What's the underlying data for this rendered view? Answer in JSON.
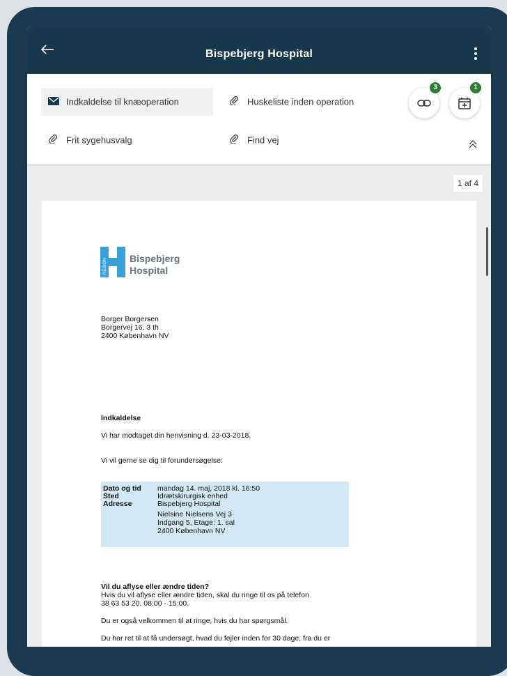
{
  "appbar": {
    "title": "Bispebjerg Hospital"
  },
  "attachments": {
    "items": [
      {
        "label": "Indkaldelse til knæoperation",
        "icon": "envelope-icon",
        "active": true
      },
      {
        "label": "Huskeliste inden operation",
        "icon": "paperclip-icon",
        "active": false
      },
      {
        "label": "Frit sygehusvalg",
        "icon": "paperclip-icon",
        "active": false
      },
      {
        "label": "Find vej",
        "icon": "paperclip-icon",
        "active": false
      }
    ],
    "links_badge": "3",
    "calendar_badge": "1"
  },
  "viewer": {
    "page_count": "1 af 4"
  },
  "document": {
    "logo_side_text": "REGION",
    "logo_line1": "Bispebjerg",
    "logo_line2": "Hospital",
    "recipient": {
      "name": "Borger Borgersen",
      "street": "Borgervej 16, 3 th",
      "city": "2400 København NV"
    },
    "heading": "Indkaldelse",
    "line1": "Vi har modtaget din henvisning d. 23-03-2018.",
    "line2": "Vi vil gerne se dig til  forundersøgelse:",
    "info": {
      "date_label": "Dato og tid",
      "date_value": "mandag 14. maj, 2018 kl. 16:50",
      "place_label": "Sted",
      "place_value": "Idrætskirurgisk enhed",
      "address_label": "Adresse",
      "address_line1": "Bispebjerg Hospital",
      "address_line2": "Nielsine Nielsens Vej 3",
      "address_line3": "Indgang 5, Etage: 1. sal",
      "address_line4": "2400 København NV"
    },
    "cancel_heading": "Vil du aflyse eller ændre tiden?",
    "cancel_line1": "Hvis du vil aflyse eller ændre tiden, skal du ringe til os på telefon",
    "cancel_line2": "38 63 53 20, 08:00 - 15:00.",
    "welcome_line": "Du er også velkommen til at ringe, hvis du har spørgsmål.",
    "rights_line": "Du har ret til at få undersøgt, hvad du fejler inden for 30 dage, fra du er"
  },
  "colors": {
    "appbar": "#18384c",
    "badge": "#2e7d32",
    "infobox": "#d3e8f5",
    "logo_blue": "#3aa0d8"
  }
}
